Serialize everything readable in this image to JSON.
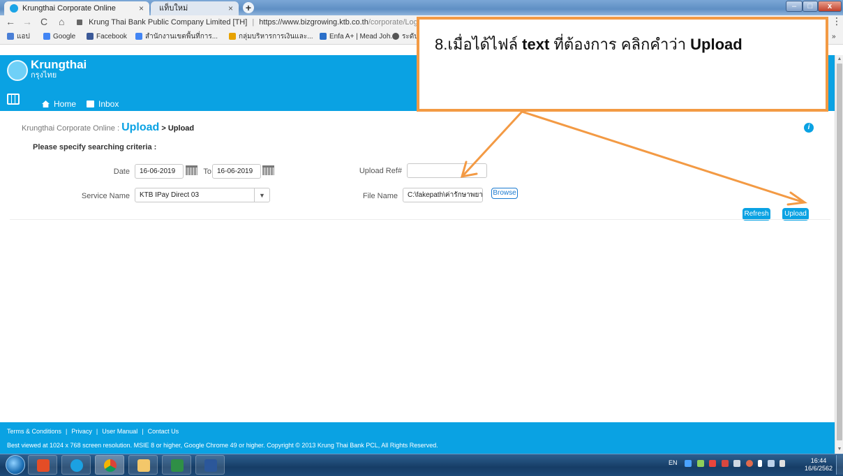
{
  "browser": {
    "tabs": [
      {
        "label": "Krungthai Corporate Online",
        "active": true
      },
      {
        "label": "แท็บใหม่",
        "active": false
      }
    ],
    "new_tab_symbol": "+",
    "address": {
      "site_label": "Krung Thai Bank Public Company Limited [TH]",
      "separator": "|",
      "url_host": "https://www.bizgrowing.ktb.co.th",
      "url_path": "/corporate/Login."
    },
    "bookmarks": [
      {
        "label": "แอป",
        "icon": "apps-icon",
        "color": "#4a7fd6"
      },
      {
        "label": "Google",
        "icon": "google-icon",
        "color": "#4285f4"
      },
      {
        "label": "Facebook",
        "icon": "facebook-icon",
        "color": "#3b5998"
      },
      {
        "label": "สำนักงานเขตพื้นที่การ...",
        "icon": "google-icon",
        "color": "#4285f4"
      },
      {
        "label": "กลุ่มบริหารการเงินและ...",
        "icon": "school-icon",
        "color": "#e7a200"
      },
      {
        "label": "Enfa A+ | Mead Joh...",
        "icon": "enfa-icon",
        "color": "#2a6fc9"
      },
      {
        "label": "ระดับ",
        "icon": "globe-icon",
        "color": "#555555"
      }
    ],
    "bookmarks_overflow": "»"
  },
  "site": {
    "brand": "Krungthai",
    "brand_thai": "กรุงไทย",
    "nav": [
      {
        "label": "Home",
        "icon": "home-icon"
      },
      {
        "label": "Inbox",
        "icon": "inbox-icon"
      }
    ],
    "colors": {
      "primary": "#0aa2e3",
      "callout": "#f39a44"
    }
  },
  "breadcrumb": {
    "root": "Krungthai Corporate Online :",
    "section": "Upload",
    "current": "> Upload"
  },
  "form": {
    "criteria_label": "Please specify searching criteria :",
    "date_label": "Date",
    "date_from": "16-06-2019",
    "to_label": "To",
    "date_to": "16-06-2019",
    "upload_ref_label": "Upload Ref#",
    "upload_ref_value": "",
    "service_label": "Service Name",
    "service_value": "KTB IPay Direct 03",
    "file_label": "File Name",
    "file_value": "C:\\fakepath\\ค่ารักษาพยาบ",
    "browse_label": "Browse",
    "refresh_label": "Refresh",
    "upload_label": "Upload"
  },
  "footer": {
    "links": [
      "Terms & Conditions",
      "Privacy",
      "User Manual",
      "Contact Us"
    ],
    "copyright": "Best viewed at 1024 x 768 screen resolution. MSIE 8 or higher, Google Chrome 49 or higher. Copyright © 2013 Krung Thai Bank PCL, All Rights Reserved."
  },
  "callout": {
    "prefix": "8.เมื่อได้ไฟล์ ",
    "bold1": "text",
    "middle": " ที่ต้องการ คลิกคำว่า ",
    "bold2": "Upload"
  },
  "taskbar": {
    "lang": "EN",
    "time": "16:44",
    "date": "16/6/2562"
  }
}
